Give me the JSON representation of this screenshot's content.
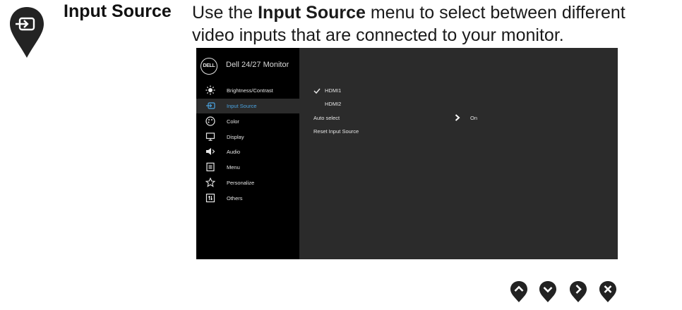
{
  "heading": "Input Source",
  "description": {
    "prefix": "Use the ",
    "bold": "Input Source",
    "suffix": " menu to select between different video inputs that are connected to your monitor."
  },
  "osd": {
    "logo_text": "DELL",
    "title": "Dell 24/27 Monitor",
    "menu": [
      {
        "label": "Brightness/Contrast",
        "icon": "brightness-icon",
        "active": false
      },
      {
        "label": "Input Source",
        "icon": "input-source-icon",
        "active": true
      },
      {
        "label": "Color",
        "icon": "color-palette-icon",
        "active": false
      },
      {
        "label": "Display",
        "icon": "display-icon",
        "active": false
      },
      {
        "label": "Audio",
        "icon": "speaker-icon",
        "active": false
      },
      {
        "label": "Menu",
        "icon": "menu-list-icon",
        "active": false
      },
      {
        "label": "Personalize",
        "icon": "star-icon",
        "active": false
      },
      {
        "label": "Others",
        "icon": "others-icon",
        "active": false
      }
    ],
    "options": [
      {
        "label": "HDMI1",
        "selected": true
      },
      {
        "label": "HDMI2",
        "selected": false
      },
      {
        "label": "Auto select",
        "value": "On"
      },
      {
        "label": "Reset Input Source"
      }
    ]
  },
  "nav_buttons": [
    "up-icon",
    "down-icon",
    "right-icon",
    "close-icon"
  ],
  "colors": {
    "osd_bg": "#2b2b2b",
    "sidebar_bg": "#000000",
    "active_text": "#4aa3e0",
    "button_fill": "#222222"
  }
}
